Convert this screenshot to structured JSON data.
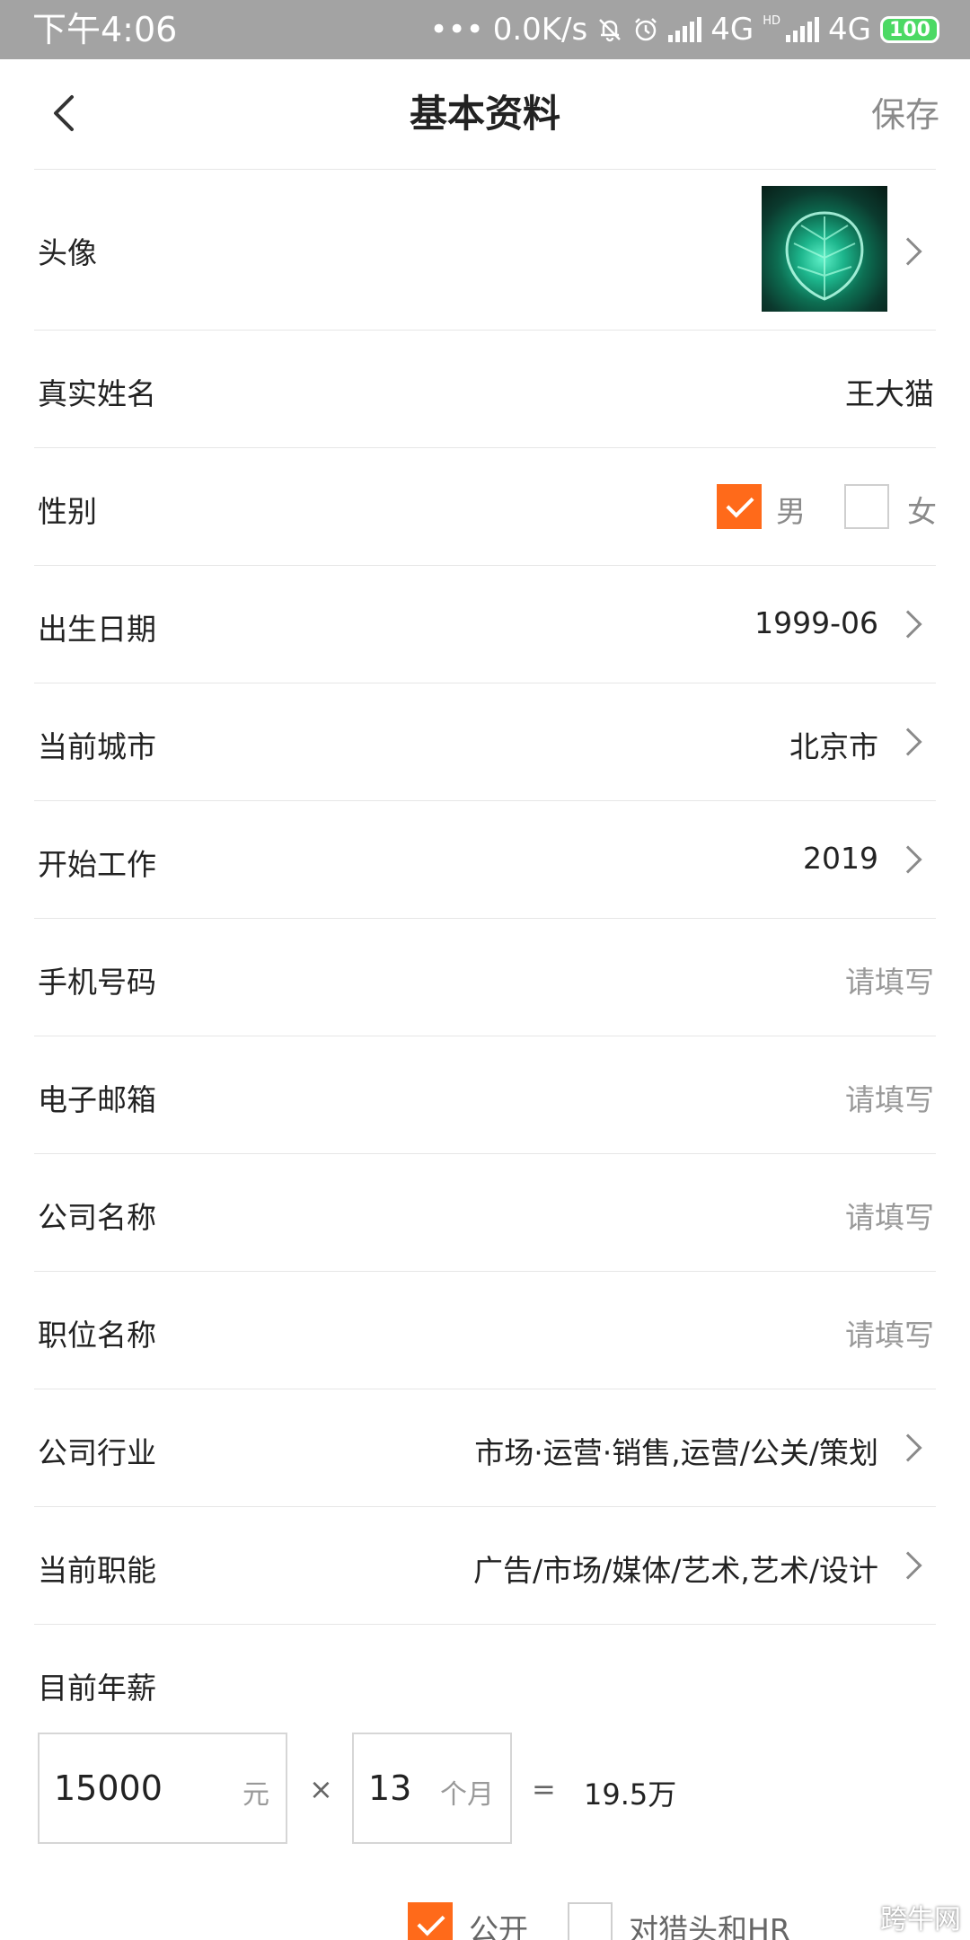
{
  "status_bar": {
    "time": "下午4:06",
    "net_speed": "0.0K/s",
    "network1": "4G",
    "hd": "HD",
    "network2": "4G",
    "battery": "100"
  },
  "header": {
    "title": "基本资料",
    "save_label": "保存"
  },
  "rows": {
    "avatar": {
      "label": "头像"
    },
    "real_name": {
      "label": "真实姓名",
      "value": "王大猫"
    },
    "gender": {
      "label": "性别",
      "male": "男",
      "female": "女",
      "selected": "男"
    },
    "birth_date": {
      "label": "出生日期",
      "value": "1999-06"
    },
    "current_city": {
      "label": "当前城市",
      "value": "北京市"
    },
    "start_work": {
      "label": "开始工作",
      "value": "2019"
    },
    "phone": {
      "label": "手机号码",
      "placeholder": "请填写"
    },
    "email": {
      "label": "电子邮箱",
      "placeholder": "请填写"
    },
    "company_name": {
      "label": "公司名称",
      "placeholder": "请填写"
    },
    "job_title": {
      "label": "职位名称",
      "placeholder": "请填写"
    },
    "industry": {
      "label": "公司行业",
      "value": "市场·运营·销售,运营/公关/策划"
    },
    "function": {
      "label": "当前职能",
      "value": "广告/市场/媒体/艺术,艺术/设计"
    }
  },
  "salary": {
    "label": "目前年薪",
    "monthly": "15000",
    "monthly_unit": "元",
    "times": "×",
    "months": "13",
    "months_unit": "个月",
    "equals": "=",
    "total": "19.5万"
  },
  "visibility": {
    "public_label": "公开",
    "hide_label": "对猎头和HR",
    "public_checked": true,
    "hide_checked": false
  },
  "watermark": "跨牛网"
}
